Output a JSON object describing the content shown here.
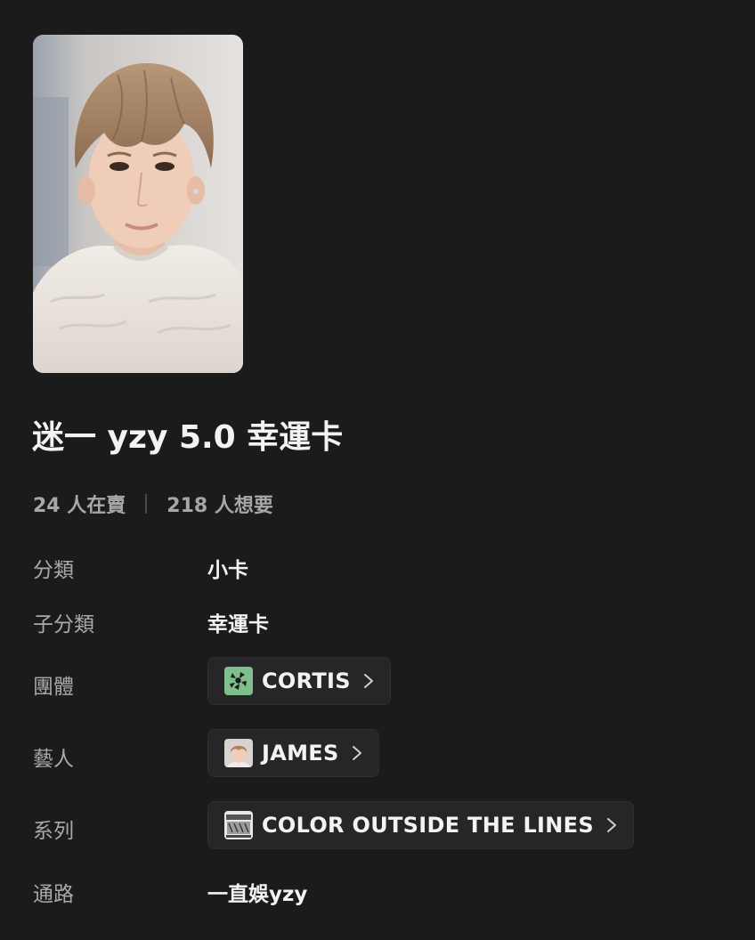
{
  "item": {
    "title": "迷一 yzy 5.0 幸運卡",
    "image_description": "photocard-portrait"
  },
  "stats": {
    "selling": "24 人在賣",
    "wanting": "218 人想要"
  },
  "details": {
    "category": {
      "label": "分類",
      "value": "小卡"
    },
    "subcategory": {
      "label": "子分類",
      "value": "幸運卡"
    },
    "group": {
      "label": "團體",
      "value": "CORTIS",
      "icon": "group-logo-icon"
    },
    "artist": {
      "label": "藝人",
      "value": "JAMES",
      "icon": "artist-avatar"
    },
    "series": {
      "label": "系列",
      "value": "COLOR OUTSIDE THE LINES",
      "icon": "album-cover-icon"
    },
    "channel": {
      "label": "通路",
      "value": "一直娛yzy"
    }
  },
  "colors": {
    "background": "#1b1b1c",
    "chip_background": "#262628",
    "label_text": "#a9a9a9",
    "value_text": "#f3f3f3",
    "group_logo_green": "#7fbf8e"
  },
  "icons": {
    "chevron": "chevron-right-icon"
  }
}
